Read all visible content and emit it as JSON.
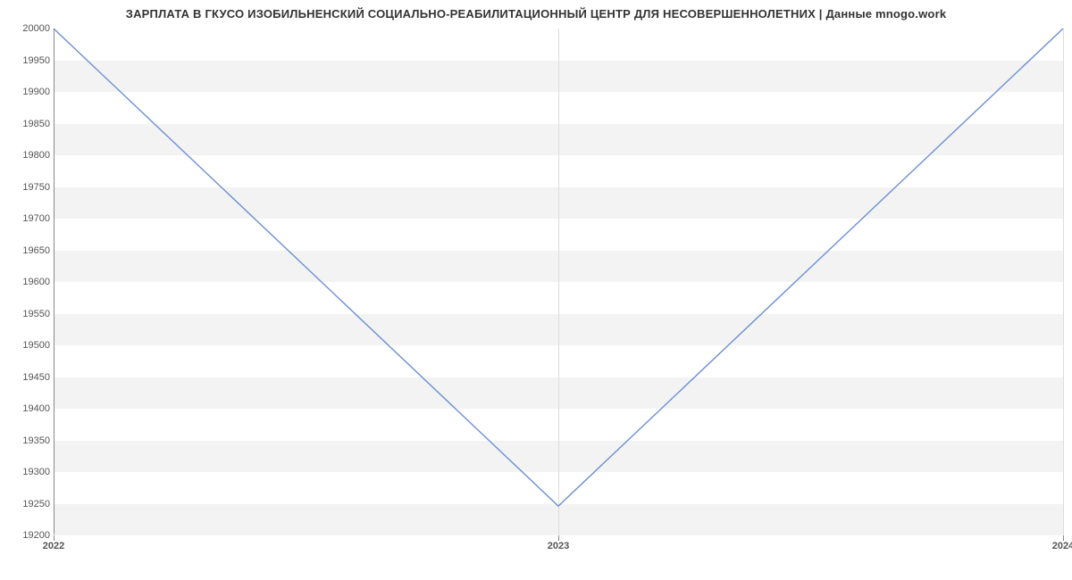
{
  "chart_data": {
    "type": "line",
    "title": "ЗАРПЛАТА В ГКУСО ИЗОБИЛЬНЕНСКИЙ СОЦИАЛЬНО-РЕАБИЛИТАЦИОННЫЙ ЦЕНТР ДЛЯ НЕСОВЕРШЕННОЛЕТНИХ | Данные mnogo.work",
    "xlabel": "",
    "ylabel": "",
    "x": [
      "2022",
      "2023",
      "2024"
    ],
    "values": [
      20000,
      19245,
      20000
    ],
    "ylim": [
      19200,
      20000
    ],
    "yticks": [
      19200,
      19250,
      19300,
      19350,
      19400,
      19450,
      19500,
      19550,
      19600,
      19650,
      19700,
      19750,
      19800,
      19850,
      19900,
      19950,
      20000
    ],
    "xticks": [
      "2022",
      "2023",
      "2024"
    ],
    "line_color": "#6b8fd4",
    "band_color": "#f3f3f3"
  }
}
